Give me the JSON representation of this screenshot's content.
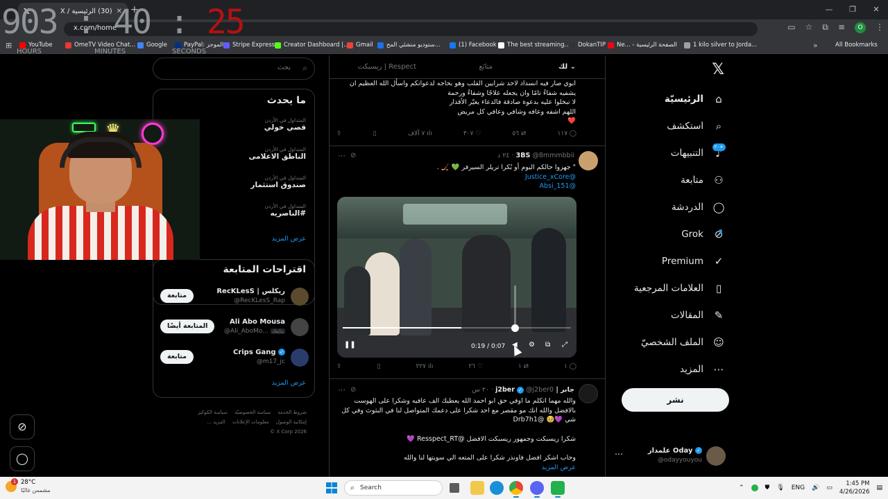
{
  "browser": {
    "tab_title": "(30) الرئيسية / X",
    "url": "x.com/home",
    "window_controls": [
      "—",
      "❐",
      "✕"
    ],
    "bookmarks": [
      {
        "label": "YouTube",
        "color": "#ff0000"
      },
      {
        "label": "OmeTV Video Chat...",
        "color": "#e53935"
      },
      {
        "label": "Google",
        "color": "#4285f4"
      },
      {
        "label": "PayPal: الموجز",
        "color": "#003087"
      },
      {
        "label": "Stripe Express",
        "color": "#635bff"
      },
      {
        "label": "Creator Dashboard |...",
        "color": "#53fc18"
      },
      {
        "label": "Gmail",
        "color": "#ea4335"
      },
      {
        "label": "ستوديو منشئي المح...",
        "color": "#1a73e8"
      },
      {
        "label": "(1) Facebook",
        "color": "#1877f2"
      },
      {
        "label": "The best streaming...",
        "color": "#ffffff"
      },
      {
        "label": "DokanTIP",
        "color": "#333333"
      },
      {
        "label": "Ne... - الصفحة الرئيسية",
        "color": "#e50914"
      },
      {
        "label": "1 kilo silver to Jorda...",
        "color": "#9aa0a6"
      }
    ],
    "all_bookmarks": "All Bookmarks",
    "profile_initial": "O"
  },
  "overlay_timer": {
    "hours_minutes": "903 : 40 : ",
    "seconds": "25",
    "labels": [
      "HOURS",
      "MINUTES",
      "SECONDS"
    ]
  },
  "nav": {
    "items": [
      {
        "label": "الرئيسيّة",
        "icon": "home-icon",
        "glyph": "⌂"
      },
      {
        "label": "استكشف",
        "icon": "search-icon",
        "glyph": "⌕"
      },
      {
        "label": "التنبيهات",
        "icon": "bell-icon",
        "glyph": "♪"
      },
      {
        "label": "متابعة",
        "icon": "add-user-icon",
        "glyph": "⚇"
      },
      {
        "label": "الدردشة",
        "icon": "chat-icon",
        "glyph": "◯"
      },
      {
        "label": "Grok",
        "icon": "grok-icon",
        "glyph": "⊘"
      },
      {
        "label": "Premium",
        "icon": "verified-icon",
        "glyph": "✓"
      },
      {
        "label": "العلامات المرجعية",
        "icon": "bookmark-icon",
        "glyph": "▯"
      },
      {
        "label": "المقالات",
        "icon": "article-icon",
        "glyph": "✎"
      },
      {
        "label": "الملف الشخصيّ",
        "icon": "profile-icon",
        "glyph": "☺"
      },
      {
        "label": "المزيد",
        "icon": "more-icon",
        "glyph": "⋯"
      }
    ],
    "notif_badge": "+٢٠",
    "post_button": "نشر",
    "account": {
      "name": "علمدار Oday",
      "handle": "@odayyouyou"
    }
  },
  "timeline": {
    "tabs": [
      "لك",
      "متابَع",
      "ريسبكت | Respect"
    ],
    "tweet1": {
      "lines": [
        "ابوي صار فيه انسداد لاحد شرايين القلب وهو بحاجه لدعواتكم واسأل الله العظيم ان",
        "يشفيه شفاءً تامًا وان يجعله علاجًا وشفاءً ورحمة",
        "لا تبخلوا عليه بدعوة صادقة فالدعاء يغيّر الأقدار",
        "اللهم اشفه وعافه وشافي وعافي كل مريض"
      ],
      "heart": "❤️",
      "actions": {
        "replies": "١١٧",
        "reposts": "٥٦",
        "likes": "٣٠٧",
        "views": "٧ آلاف"
      }
    },
    "tweet2": {
      "display_name": "3BS",
      "handle": "@8mmmbbii",
      "time": "٢٤ د",
      "text": "\" جهزوا حالكم اليوم أو بُكرا تريلر السيرفر 💚 🏒 .",
      "mentions": [
        "@Justice_xCore",
        "@Absi_151"
      ],
      "video_time": "0:19 / 0:07",
      "video_progress": 0.52,
      "actions": {
        "replies": "١",
        "reposts": "١",
        "likes": "٢٦",
        "views": "٢٢٧"
      }
    },
    "tweet3": {
      "display_name": "جابر | j2ber",
      "handle": "@j2ber0",
      "time": "٢٠ س",
      "lines": [
        "والله مهما اتكلم ما اوفي حق ابو احمد الله يعطيك الف عافيه وشكرا على الهوست",
        "بالافضل والله انك مو مقصر مع احد شكرا على دعمك المتواصل لنا في البثوث وفي كل",
        "شي 💜🥹 @Drb7h1"
      ],
      "line4": "شكرا ريسبكت وجمهور ريسبكت الافضل @Resspect_RT 💜",
      "line5": "وحاب اشكر افضل فاونذر شكرا على المتعه الي سويتها لنا والله",
      "show_more": "عرض المزيد"
    }
  },
  "sidebar": {
    "search_placeholder": "بحث",
    "trends_title": "ما يحدث",
    "trends": [
      {
        "context": "المتداول في الأردن",
        "name": "قصي خولي"
      },
      {
        "context": "المتداول في الأردن",
        "name": "الناطق الاعلامى"
      },
      {
        "context": "المتداول في الأردن",
        "name": "صندوق استثمار"
      },
      {
        "context": "المتداول في الأردن",
        "name": "#الناصريه"
      }
    ],
    "show_more": "عرض المزيد",
    "follows_title": "اقتراحات المتابعة",
    "follows": [
      {
        "name": "RecKLesS | ريكلس",
        "handle": "@RecKLesS_Rap",
        "button": "متابعة",
        "color": "#5a4a2e"
      },
      {
        "name": "Ali Abo Mousa",
        "handle": "@Ali_AboMo...",
        "button": "المتابعة أيضًا",
        "color": "#444444"
      },
      {
        "name": "Crips Gang",
        "handle": "@m17_jc",
        "button": "متابعة",
        "color": "#2a3c6a"
      }
    ],
    "follows_show_more": "عرض المزيد",
    "follows_you_badge": "يتابعك",
    "footer": [
      "شروط الخدمة",
      "سياسة الخصوصيّة",
      "سياسة الكوكيز",
      "إمكانية الوصول",
      "معلومات الإعلانات",
      "المزيد ...",
      "X Corp 2026 ©"
    ]
  },
  "taskbar": {
    "weather_temp": "28°C",
    "weather_desc": "مشمس غالبًا",
    "weather_alert": "1",
    "search_label": "Search",
    "lang": "ENG",
    "time": "1:45 PM",
    "date": "4/26/2026"
  }
}
